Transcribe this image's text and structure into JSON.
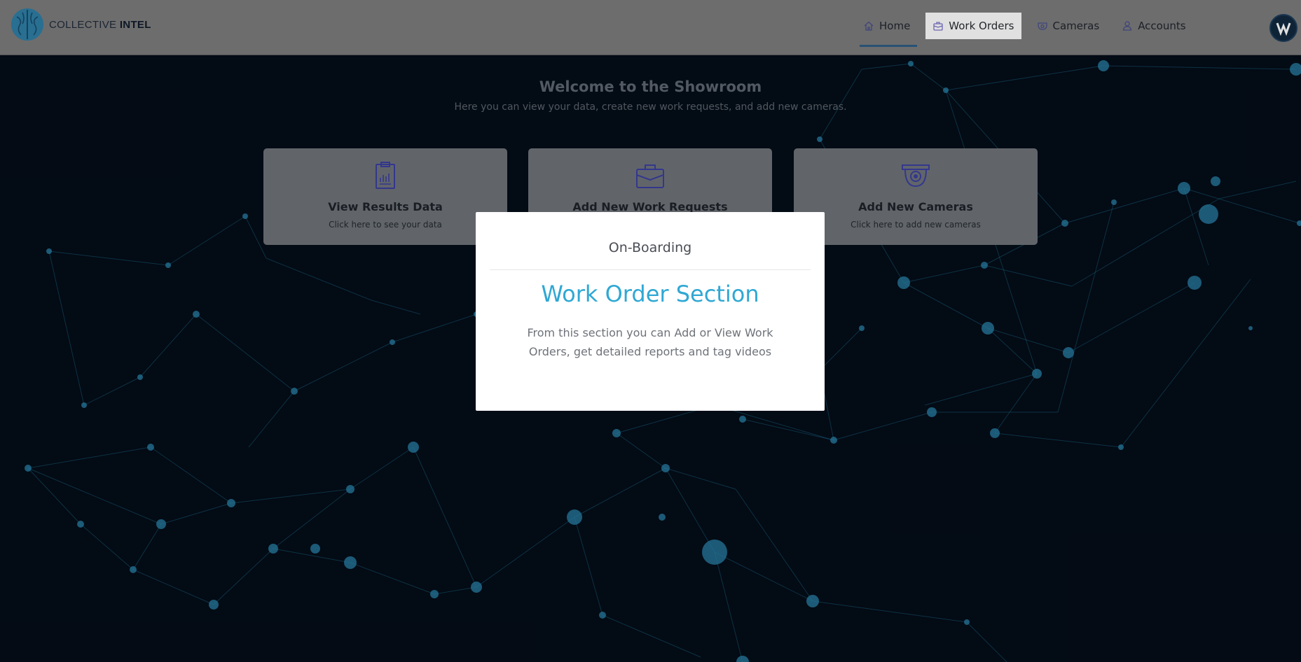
{
  "brand": {
    "name_light": "COLLECTIVE ",
    "name_bold": "INTEL"
  },
  "nav": [
    {
      "label": "Home",
      "icon": "home-icon"
    },
    {
      "label": "Work Orders",
      "icon": "briefcase-icon",
      "active": true
    },
    {
      "label": "Cameras",
      "icon": "camera-icon"
    },
    {
      "label": "Accounts",
      "icon": "user-icon"
    }
  ],
  "welcome": {
    "title": "Welcome to the Showroom",
    "subtitle": "Here you can view your data, create new work requests, and add new cameras."
  },
  "cards": [
    {
      "title": "View Results Data",
      "subtitle": "Click here to see your data",
      "icon": "clipboard-icon"
    },
    {
      "title": "Add New Work Requests",
      "subtitle": "",
      "icon": "briefcase-icon"
    },
    {
      "title": "Add New Cameras",
      "subtitle": "Click here to add new cameras",
      "icon": "security-camera-icon"
    }
  ],
  "modal": {
    "title": "On-Boarding",
    "heading": "Work Order Section",
    "body": "From this section you can Add or View Work Orders, get detailed reports and tag videos"
  },
  "colors": {
    "accent": "#2fa8d4",
    "header_bg": "#7d7d7d",
    "page_bg": "#040d18",
    "icon_purple": "#3b3fa0"
  }
}
